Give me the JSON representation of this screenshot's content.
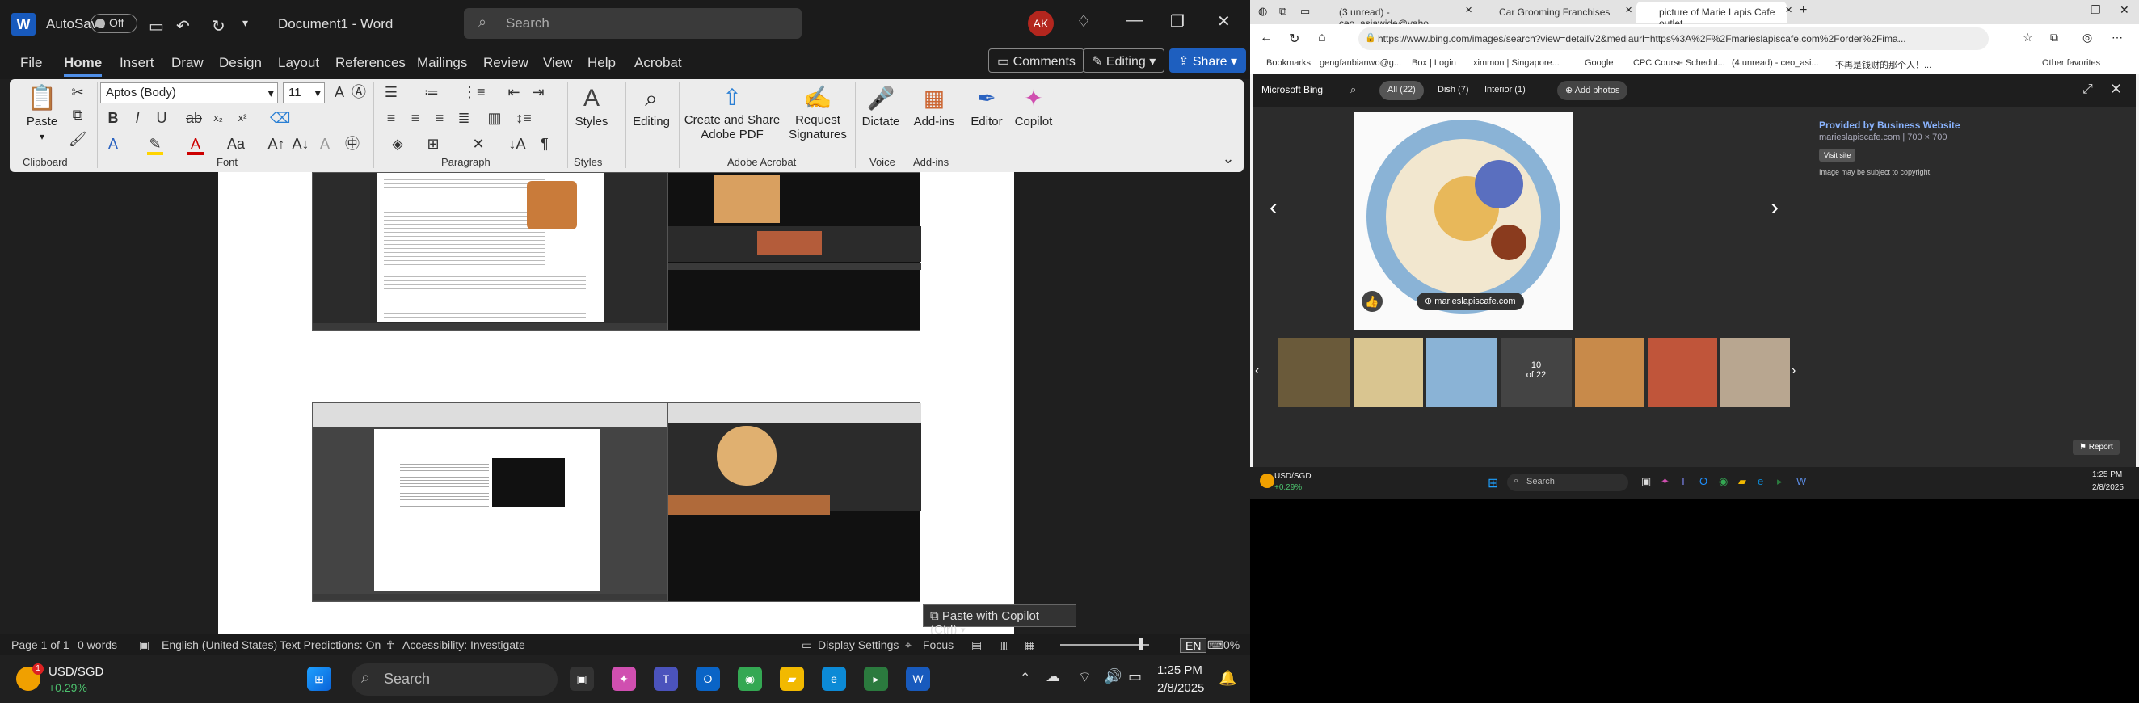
{
  "word": {
    "title": "Document1 - Word",
    "autosave": "AutoSave",
    "autosave_state": "Off",
    "search_placeholder": "Search",
    "avatar": "AK",
    "menu": [
      "File",
      "Home",
      "Insert",
      "Draw",
      "Design",
      "Layout",
      "References",
      "Mailings",
      "Review",
      "View",
      "Help",
      "Acrobat"
    ],
    "active_menu": "Home",
    "comments": "Comments",
    "editing_mode": "Editing",
    "share": "Share",
    "ribbon": {
      "paste": "Paste",
      "font_name": "Aptos (Body)",
      "font_size": "11",
      "styles": "Styles",
      "editing": "Editing",
      "create_share": "Create and Share Adobe PDF",
      "request_sig": "Request Signatures",
      "dictate": "Dictate",
      "addins": "Add-ins",
      "editor": "Editor",
      "copilot": "Copilot",
      "groups": {
        "clipboard": "Clipboard",
        "font": "Font",
        "paragraph": "Paragraph",
        "styles": "Styles",
        "acrobat": "Adobe Acrobat",
        "voice": "Voice",
        "addins": "Add-ins"
      }
    },
    "paste_copilot": "Paste with Copilot (Ctrl)",
    "status": {
      "page": "Page 1 of 1",
      "words": "0 words",
      "language": "English (United States)",
      "predictions": "Text Predictions: On",
      "accessibility": "Accessibility: Investigate",
      "display": "Display Settings",
      "focus": "Focus",
      "lang_badge": "EN",
      "zoom": "0%"
    }
  },
  "taskbar": {
    "weather_label": "USD/SGD",
    "weather_value": "+0.29%",
    "badge": "1",
    "search": "Search",
    "time": "1:25 PM",
    "date": "2/8/2025"
  },
  "edge": {
    "tabs": [
      "(3 unread) - ceo_asiawide@yaho",
      "Car Grooming Franchises",
      "picture of Marie Lapis Cafe outlet"
    ],
    "url": "https://www.bing.com/images/search?view=detailV2&mediaurl=https%3A%2F%2Fmarieslapiscafe.com%2Forder%2Fima...",
    "bookmarks": [
      "Bookmarks",
      "gengfanbianwo@g...",
      "Box | Login",
      "ximmon | Singapore...",
      "Google",
      "CPC Course Schedul...",
      "(4 unread) - ceo_asi...",
      "不再是钱财的那个人！..."
    ],
    "other_favorites": "Other favorites",
    "bing": "Microsoft Bing",
    "filters": [
      "All (22)",
      "Dish (7)",
      "Interior (1)"
    ],
    "add_photos": "Add photos",
    "source_badge": "marieslapiscafe.com",
    "provided_by": "Provided by Business Website",
    "site": "marieslapiscafe.com",
    "dims": "700 × 700",
    "visit": "Visit site",
    "copyright": "Image may be subject to copyright.",
    "counter": "10",
    "counter_of": "of 22",
    "report": "Report"
  },
  "edge_taskbar": {
    "weather_label": "USD/SGD",
    "weather_value": "+0.29%",
    "search": "Search",
    "time": "1:25 PM",
    "date": "2/8/2025"
  }
}
